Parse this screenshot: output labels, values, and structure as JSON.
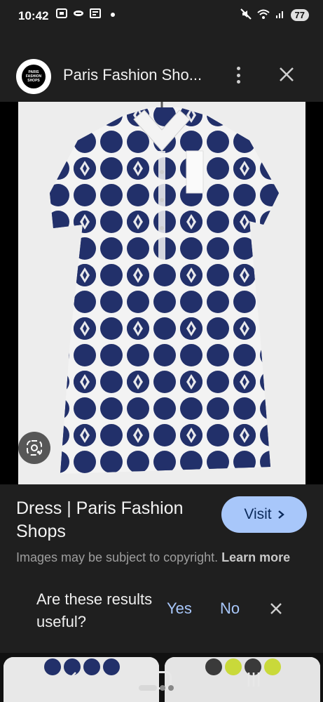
{
  "status_bar": {
    "time": "10:42",
    "battery": "77",
    "left_icons": [
      "screenshot-icon",
      "spotify-icon",
      "news-icon"
    ],
    "right_icons": [
      "mute-icon",
      "wifi-icon",
      "signal-icon"
    ]
  },
  "header": {
    "logo_text": "PARIS FASHION SHOPS",
    "title": "Paris Fashion Sho..."
  },
  "image": {
    "description_icon": "lens-icon",
    "colors": {
      "navy": "#22306a",
      "white": "#f3f3f3",
      "backdrop": "#ededed"
    }
  },
  "result": {
    "title": "Dress | Paris Fashion Shops",
    "visit_label": "Visit",
    "copyright_text": "Images may be subject to copyright.",
    "learn_more": "Learn more"
  },
  "feedback": {
    "question": "Are these results useful?",
    "yes": "Yes",
    "no": "No"
  },
  "colors": {
    "panel": "#1f1f1f",
    "accent": "#a8c7fa"
  }
}
